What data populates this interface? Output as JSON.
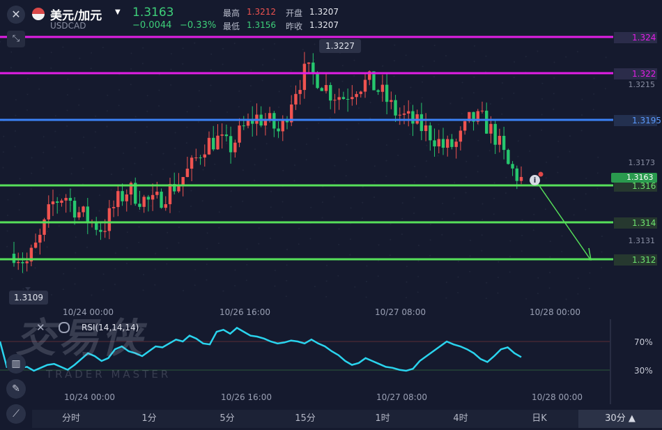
{
  "header": {
    "pair": "美元/加元",
    "symbol": "USDCAD",
    "price": "1.3163",
    "change": "−0.0044",
    "change_pct": "−0.33%",
    "high_label": "最高",
    "high": "1.3212",
    "open_label": "开盘",
    "open": "1.3207",
    "low_label": "最低",
    "low": "1.3156",
    "prev_label": "昨收",
    "prev": "1.3207"
  },
  "colors": {
    "up": "#ef5350",
    "down": "#26c76e",
    "magenta": "#e21ee6",
    "blue": "#3b82f6",
    "green_line": "#56e05a",
    "rsi": "#2ad4ee"
  },
  "levels": [
    {
      "label": "1.324",
      "color": "#e21ee6"
    },
    {
      "label": "1.322",
      "color": "#e21ee6"
    },
    {
      "label": "1.3195",
      "color": "#3b82f6"
    },
    {
      "label": "1.316",
      "color": "#56e05a"
    },
    {
      "label": "1.314",
      "color": "#56e05a"
    },
    {
      "label": "1.312",
      "color": "#56e05a"
    }
  ],
  "yaxis_labels": [
    "1.3215",
    "1.3173",
    "1.3131"
  ],
  "current_price_tag": "1.3163",
  "annotations": {
    "max": "1.3227",
    "min": "1.3109"
  },
  "time_ticks": [
    "10/24 00:00",
    "10/26 16:00",
    "10/27 08:00",
    "10/28 00:00"
  ],
  "rsi": {
    "label": "RSI(14,14,14)",
    "upper": "70%",
    "lower": "30%"
  },
  "watermark": {
    "cn": "交易侠",
    "en": "TRADER MASTER"
  },
  "timeframes": [
    "分时",
    "1分",
    "5分",
    "15分",
    "1时",
    "4时",
    "日K"
  ],
  "selected_timeframe": "30分",
  "icons": [
    "close-icon",
    "flag-icon",
    "dropdown-icon",
    "expand-icon",
    "info-icon",
    "indicator-icon",
    "pen-icon",
    "trend-icon",
    "settings-icon"
  ]
}
